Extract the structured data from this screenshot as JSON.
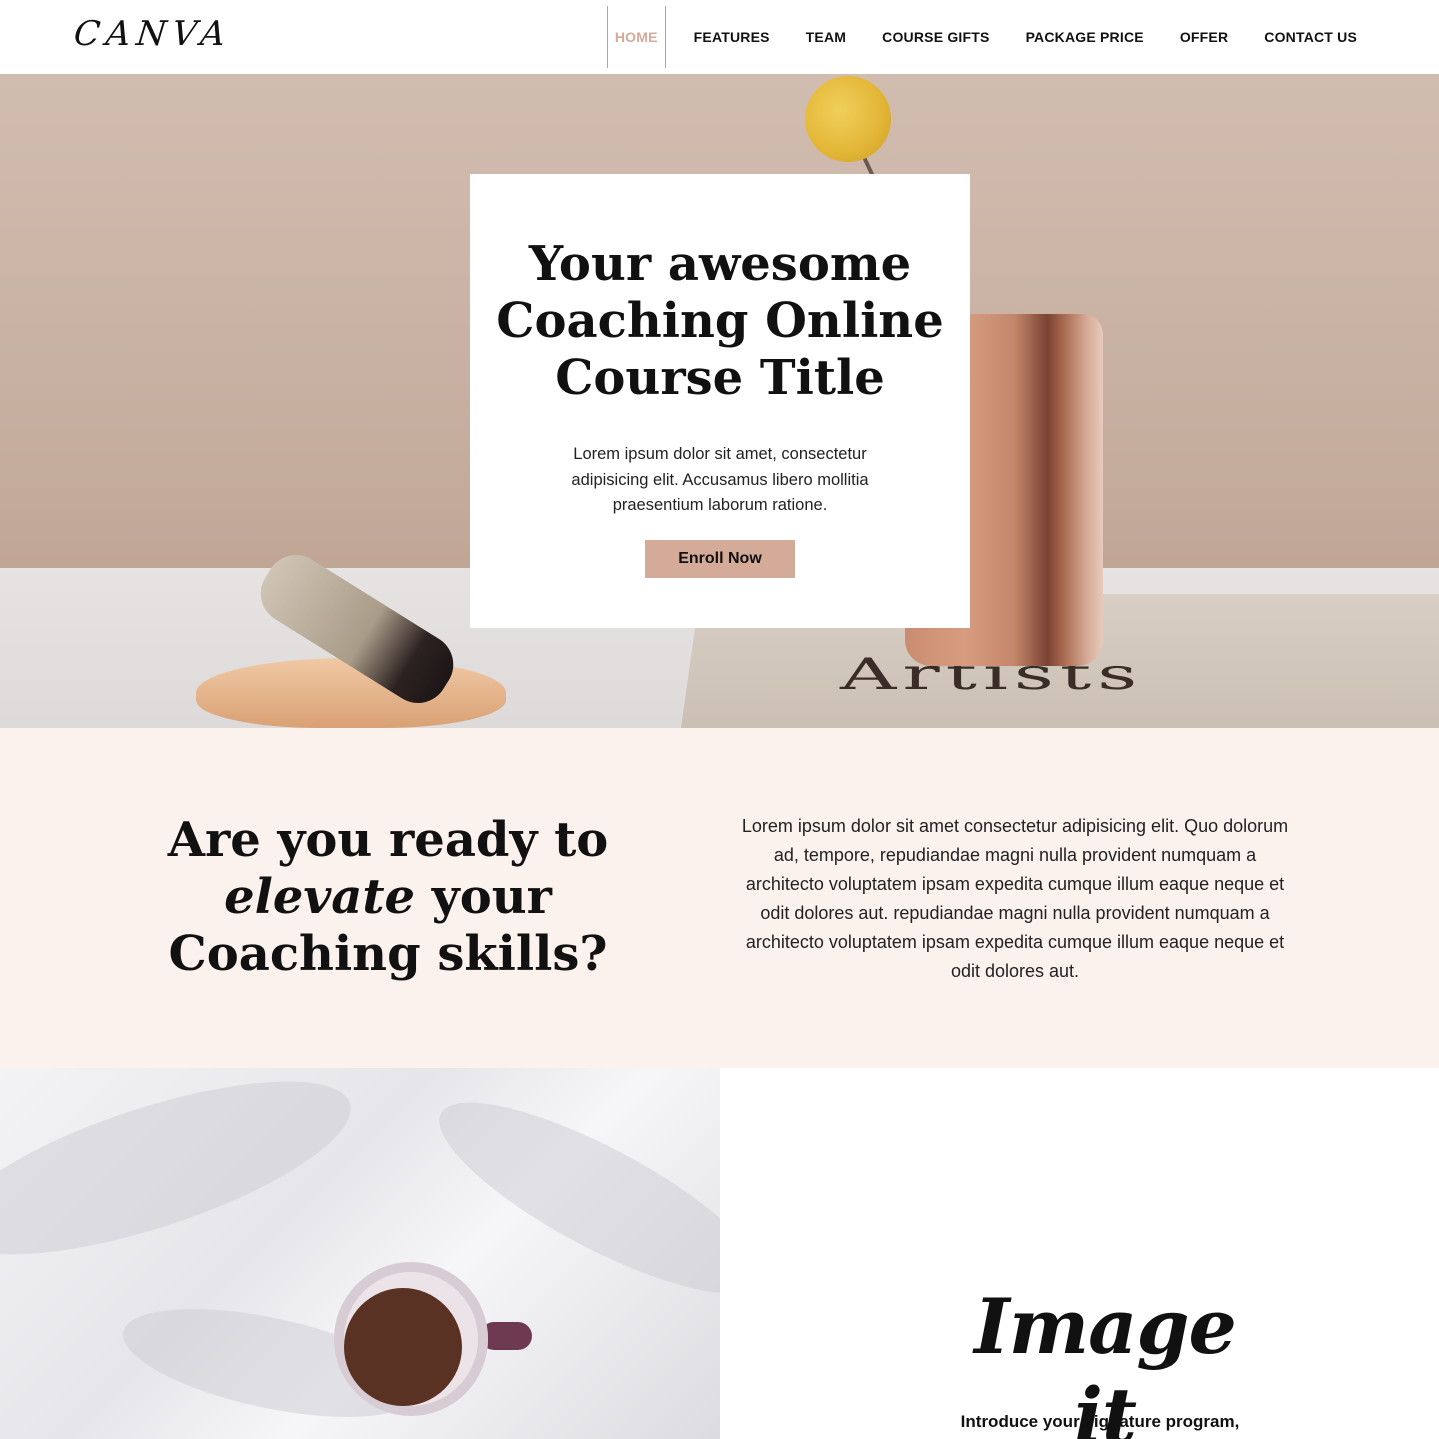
{
  "header": {
    "logo": "CANVA",
    "nav": [
      {
        "label": "HOME",
        "active": true
      },
      {
        "label": "FEATURES",
        "active": false
      },
      {
        "label": "TEAM",
        "active": false
      },
      {
        "label": "COURSE GIFTS",
        "active": false
      },
      {
        "label": "PACKAGE PRICE",
        "active": false
      },
      {
        "label": "OFFER",
        "active": false
      },
      {
        "label": "CONTACT US",
        "active": false
      }
    ]
  },
  "hero": {
    "title": "Your awesome Coaching Online Course Title",
    "text": "Lorem ipsum dolor sit amet, consectetur adipisicing elit. Accusamus libero mollitia praesentium laborum ratione.",
    "button_label": "Enroll Now",
    "background_text": "Artists"
  },
  "elevate": {
    "heading_before": "Are you ready to ",
    "heading_emphasis": "elevate",
    "heading_after": " your Coaching skills?",
    "text": "Lorem ipsum dolor sit amet consectetur adipisicing elit. Quo dolorum ad, tempore, repudiandae magni nulla provident numquam a architecto voluptatem ipsam expedita cumque illum eaque neque et odit dolores aut. repudiandae magni nulla provident numquam a architecto voluptatem ipsam expedita cumque illum eaque neque et odit dolores aut."
  },
  "feature": {
    "script_title": "Image it",
    "intro": "Introduce your signature program,"
  },
  "colors": {
    "accent": "#d4aa98",
    "section_bg": "#fbf1ed",
    "text": "#111111"
  }
}
